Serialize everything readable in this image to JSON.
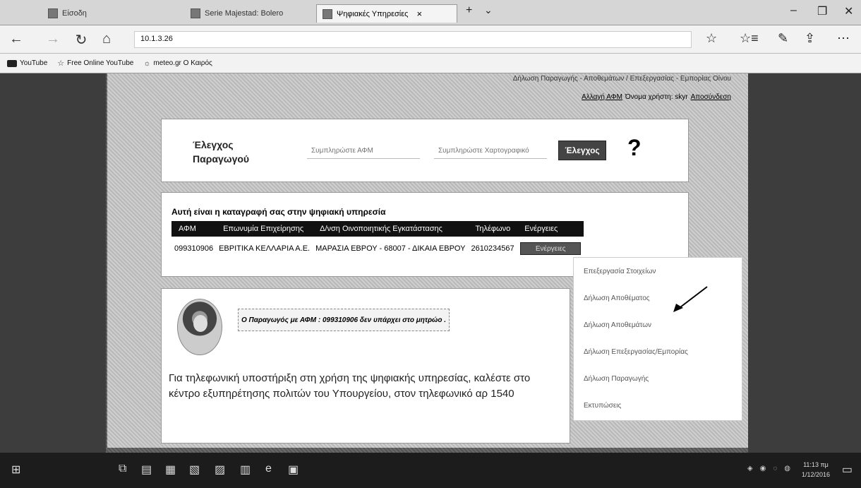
{
  "browser": {
    "tabs": [
      {
        "label": "Είσοδη",
        "active": false
      },
      {
        "label": "Serie Majestad: Bolero",
        "active": false
      },
      {
        "label": "Ψηφιακές Υπηρεσίες",
        "active": true
      }
    ],
    "tab_close": "×",
    "new_tab": "+",
    "tab_menu": "⌄",
    "win_min": "–",
    "win_max": "❐",
    "win_close": "✕",
    "back": "←",
    "forward": "→",
    "refresh": "↻",
    "home": "⌂",
    "url": "10.1.3.26",
    "favorite": "☆",
    "favorites_hub": "☆≡",
    "notes": "✎",
    "share": "⇪",
    "more": "⋯",
    "favorites": [
      {
        "label": "YouTube"
      },
      {
        "label": "Free Online YouTube"
      },
      {
        "label": "meteo.gr Ο Καιρός"
      }
    ]
  },
  "page": {
    "top_menu": "Δήλωση Παραγωγής - Αποθεμάτων / Επεξεργασίας - Εμπορίας Οίνου",
    "user": {
      "change_afm": "Αλλαγή ΑΦΜ",
      "username_label": "Όνομα χρήστη: skyr",
      "logout": "Αποσύνδεση"
    },
    "check": {
      "title": "Έλεγχος Παραγωγού",
      "afm_placeholder": "Συμπληρώστε ΑΦΜ",
      "code_placeholder": "Συμπληρώστε Χαρτογραφικό",
      "button": "Έλεγχος",
      "help": "?"
    },
    "registry": {
      "title": "Αυτή είναι η καταγραφή σας στην ψηφιακή υπηρεσία",
      "headers": [
        "ΑΦΜ",
        "Επωνυμία Επιχείρησης",
        "Δ/νση Οινοποιητικής Εγκατάστασης",
        "Τηλέφωνο",
        "Ενέργειες"
      ],
      "row": {
        "afm": "099310906",
        "name": "ΕΒΡΙΤΙΚΑ ΚΕΛΛΑΡΙΑ Α.Ε.",
        "address": "ΜΑΡΑΣΙΑ ΕΒΡΟΥ - 68007 - ΔΙΚΑΙΑ ΕΒΡΟΥ",
        "phone": "2610234567",
        "action_btn": "Ενέργειες"
      }
    },
    "actions_menu": [
      "Επεξεργασία Στοιχείων",
      "Δήλωση Αποθέματος",
      "Δήλωση Αποθεμάτων",
      "Δήλωση Επεξεργασίας/Εμπορίας",
      "Δήλωση Παραγωγής",
      "Εκτυπώσεις"
    ],
    "message": "Ο Παραγωγός με ΑΦΜ : 099310906 δεν υπάρχει στο μητρώο .",
    "support_text": "Για τηλεφωνική υποστήριξη στη χρήση της ψηφιακής υπηρεσίας, καλέστε στο κέντρο εξυπηρέτησης πολιτών του Υπουργείου, στον τηλεφωνικό αρ 1540"
  },
  "taskbar": {
    "time": "11:13 πμ",
    "date": "1/12/2016"
  }
}
